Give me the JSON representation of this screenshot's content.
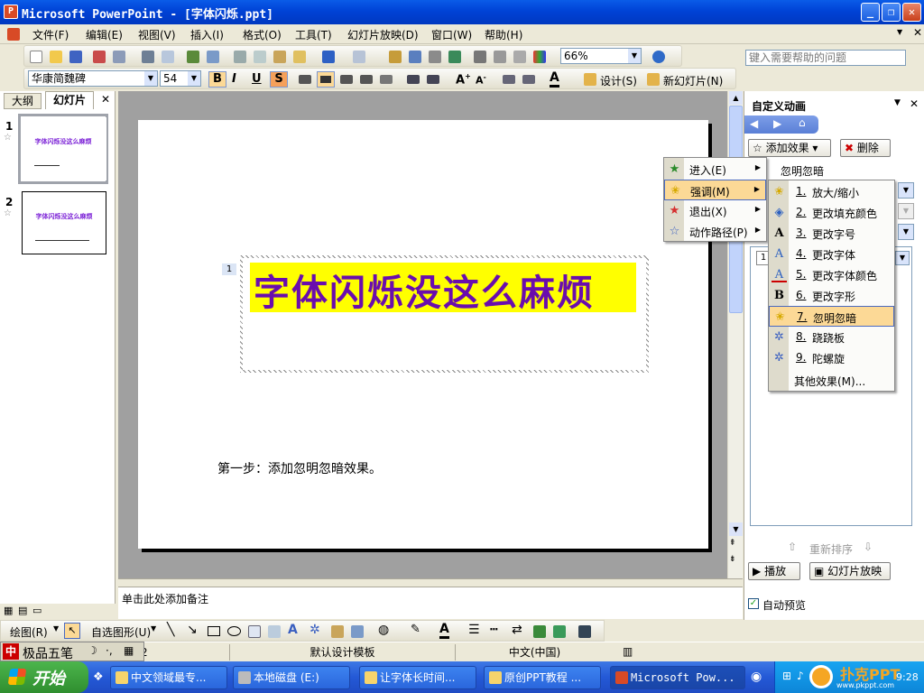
{
  "window": {
    "title": "Microsoft PowerPoint - [字体闪烁.ppt]"
  },
  "menu": [
    "文件(F)",
    "编辑(E)",
    "视图(V)",
    "插入(I)",
    "格式(O)",
    "工具(T)",
    "幻灯片放映(D)",
    "窗口(W)",
    "帮助(H)"
  ],
  "help_box": {
    "placeholder": "键入需要帮助的问题"
  },
  "toolbar": {
    "zoom": "66%",
    "font_name": "华康简魏碑",
    "font_size": "54",
    "bold": "B",
    "italic": "I",
    "underline": "U",
    "shadow": "S",
    "design_label": "设计(S)",
    "new_slide_label": "新幻灯片(N)"
  },
  "left_pane": {
    "tabs": [
      "大纲",
      "幻灯片"
    ],
    "slide_numbers": [
      "1",
      "2"
    ],
    "thumb_title": "字体闪烁没这么麻烦"
  },
  "slide": {
    "title": "字体闪烁没这么麻烦",
    "tag": "1",
    "body": "第一步：添加忽明忽暗效果。"
  },
  "notes": {
    "placeholder": "单击此处添加备注"
  },
  "task_pane": {
    "title": "自定义动画",
    "add_effect": "添加效果",
    "remove": "删除",
    "current_effect": "忽明忽暗",
    "list_item_num": "1",
    "reorder": "重新排序",
    "play": "播放",
    "slideshow": "幻灯片放映",
    "autopreview": "自动预览",
    "autopreview_checked": true
  },
  "effect_menu": [
    {
      "label": "进入(E)",
      "icon": "green-star-icon"
    },
    {
      "label": "强调(M)",
      "icon": "yellow-star-icon",
      "selected": true
    },
    {
      "label": "退出(X)",
      "icon": "red-star-icon"
    },
    {
      "label": "动作路径(P)",
      "icon": "path-star-icon"
    }
  ],
  "emphasis_menu": [
    {
      "num": "1.",
      "label": "放大/缩小",
      "icon": "grow-icon"
    },
    {
      "num": "2.",
      "label": "更改填充颜色",
      "icon": "fill-icon"
    },
    {
      "num": "3.",
      "label": "更改字号",
      "icon": "font-size-icon"
    },
    {
      "num": "4.",
      "label": "更改字体",
      "icon": "font-icon"
    },
    {
      "num": "5.",
      "label": "更改字体颜色",
      "icon": "font-color-icon"
    },
    {
      "num": "6.",
      "label": "更改字形",
      "icon": "bold-icon"
    },
    {
      "num": "7.",
      "label": "忽明忽暗",
      "icon": "flicker-icon",
      "selected": true
    },
    {
      "num": "8.",
      "label": "跷跷板",
      "icon": "teeter-icon"
    },
    {
      "num": "9.",
      "label": "陀螺旋",
      "icon": "spin-icon"
    },
    {
      "num": "",
      "label": "其他效果(M)...",
      "icon": ""
    }
  ],
  "draw_toolbar": {
    "draw": "绘图(R)",
    "autoshapes": "自选图形(U)"
  },
  "status": {
    "template": "默认设计模板",
    "language": "中文(中国)",
    "page": "2"
  },
  "ime": {
    "name": "极品五笔"
  },
  "taskbar": {
    "start": "开始",
    "tasks": [
      "中文领域最专...",
      "本地磁盘 (E:)",
      "让字体长时间...",
      "原创PPT教程 ...",
      "Microsoft Pow..."
    ],
    "clock": "9:28",
    "watermark": "扑克PPT",
    "watermark_url": "www.pkppt.com"
  },
  "colors": {
    "title_text": "#6a0dad",
    "title_highlight": "#ffff00",
    "selection": "#fcd996",
    "titlebar": "#0a5ce8"
  }
}
